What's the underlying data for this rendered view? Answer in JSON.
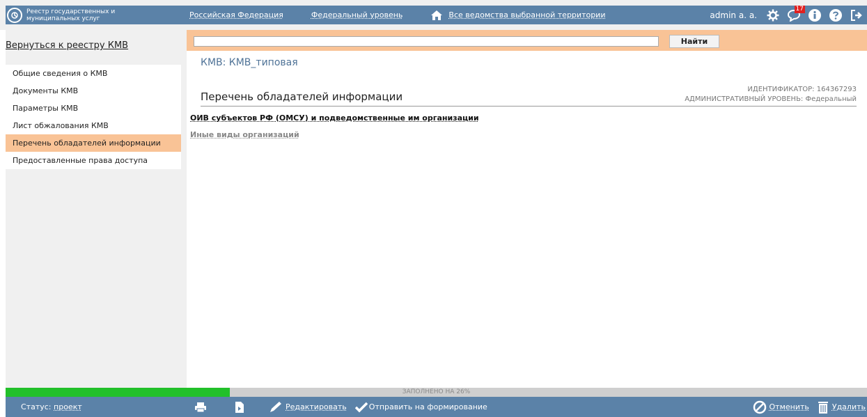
{
  "header": {
    "logo_line1": "Реестр государственных и",
    "logo_line2": "муниципальных услуг",
    "region": "Российская Федерация",
    "level": "Федеральный уровень",
    "agencies": "Все ведомства выбранной территории",
    "user": "admin a. a.",
    "notifications_count": "17"
  },
  "sidebar": {
    "back_link": "Вернуться к реестру КМВ",
    "items": [
      {
        "label": "Общие сведения о КМВ"
      },
      {
        "label": "Документы КМВ"
      },
      {
        "label": "Параметры КМВ"
      },
      {
        "label": "Лист обжалования КМВ"
      },
      {
        "label": "Перечень обладателей информации"
      },
      {
        "label": "Предоставленные права доступа"
      }
    ]
  },
  "search": {
    "value": "",
    "button": "Найти"
  },
  "main": {
    "kmv_title": "КМВ: КМВ_типовая",
    "section_title": "Перечень обладателей информации",
    "identifier": "ИДЕНТИФИКАТОР: 164367293",
    "admin_level": "АДМИНИСТРАТИВНЫЙ УРОВЕНЬ: Федеральный",
    "link_oiv": "ОИВ субъектов РФ (ОМСУ) и подведомственные им организации",
    "link_other": "Иные виды организаций"
  },
  "progress": {
    "percent": 26,
    "label": "ЗАПОЛНЕНО НА 26%"
  },
  "footer": {
    "status_label": "Статус:",
    "status_value": "проект",
    "edit": "Редактировать",
    "send": "Отправить на формирование",
    "cancel": "Отменить",
    "delete": "Удалить"
  },
  "colors": {
    "header_bg": "#5b82a8",
    "active_item": "#f9c396",
    "progress_green": "#22c02a",
    "badge": "#e02020"
  }
}
